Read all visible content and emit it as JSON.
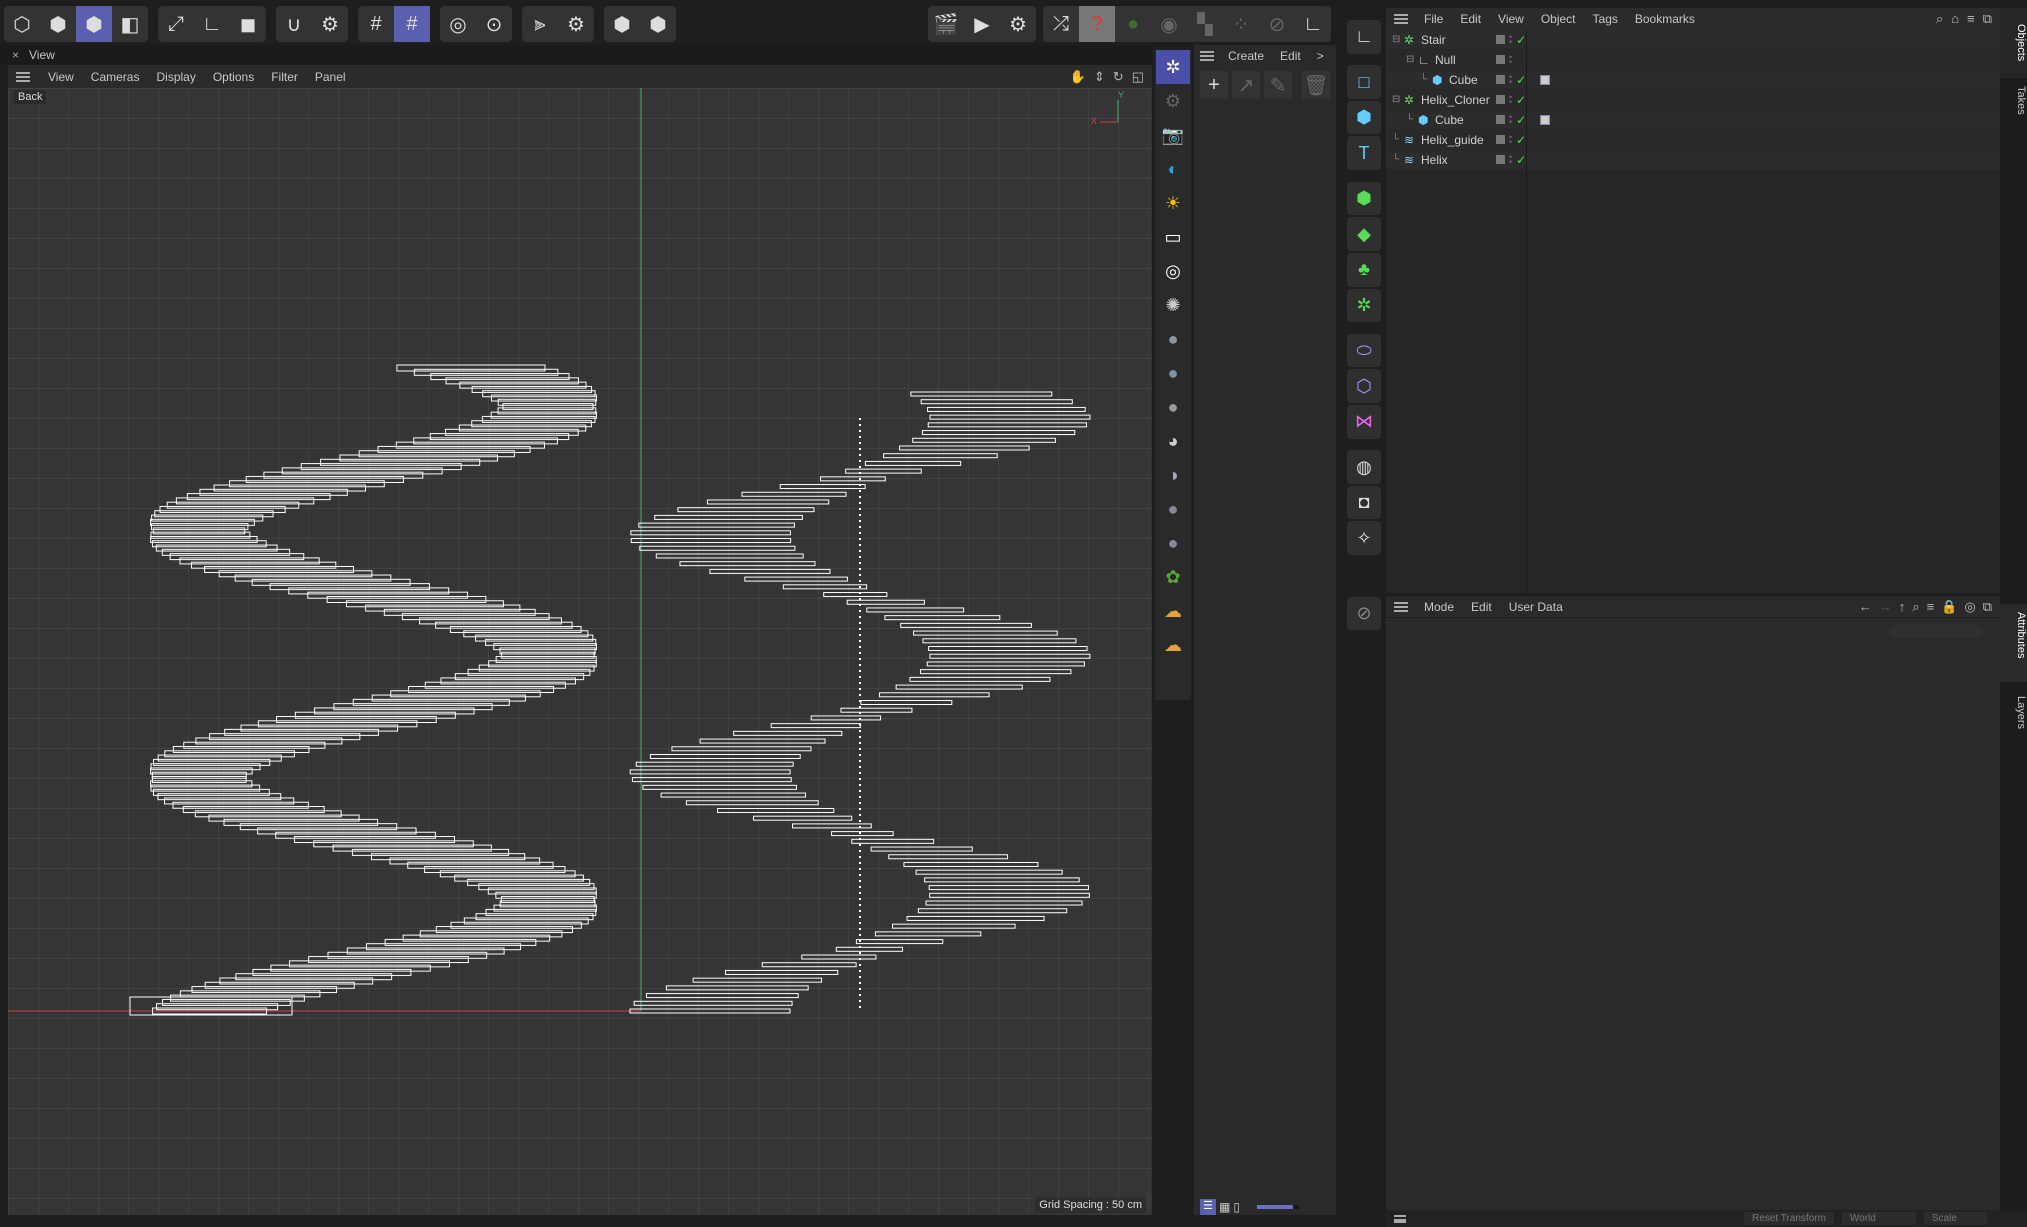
{
  "toolbar": {
    "groups": [
      {
        "icons": [
          "object-mode-icon",
          "point-mode-icon",
          "model-mode-icon",
          "polygon-mode-icon"
        ],
        "active": 2
      },
      {
        "icons": [
          "axis-move-icon",
          "axis-corner-icon",
          "texture-icon"
        ],
        "active": -1
      },
      {
        "icons": [
          "snap-magnet-icon",
          "snap-settings-icon"
        ],
        "active": -1
      },
      {
        "icons": [
          "grid-snap-icon",
          "grid-lock-icon"
        ],
        "active": 1
      },
      {
        "icons": [
          "soft-select-icon",
          "soft-settings-icon"
        ],
        "active": -1
      },
      {
        "icons": [
          "symmetry-icon",
          "symmetry-settings-icon"
        ],
        "active": -1
      },
      {
        "icons": [
          "viewport-solo-icon",
          "solo-hierarchy-icon"
        ],
        "active": -1
      }
    ],
    "render_icons": [
      "render-view-icon",
      "render-picture-icon",
      "render-settings-icon"
    ],
    "octane_icons": [
      "shuffle-icon",
      "octane-help-icon",
      "octane-ball-icon",
      "eye-icon",
      "checker-pin-icon",
      "dots-icon",
      "disable-icon",
      "axis-point-icon"
    ]
  },
  "view_panel": {
    "tab_title": "View",
    "menu": [
      "View",
      "Cameras",
      "Display",
      "Options",
      "Filter",
      "Panel"
    ],
    "camera_label": "Back",
    "grid_spacing": "Grid Spacing : 50 cm",
    "axis": {
      "x": "X",
      "y": "Y"
    },
    "colors": {
      "x_axis": "#c94444",
      "y_axis": "#3fb36c"
    }
  },
  "create_panel": {
    "menu": [
      "Create",
      "Edit",
      ">"
    ]
  },
  "objects": {
    "menu": [
      "File",
      "Edit",
      "View",
      "Object",
      "Tags",
      "Bookmarks"
    ],
    "items": [
      {
        "name": "Stair",
        "depth": 0,
        "icon": "cloner-icon",
        "expand": true,
        "check": true,
        "tag": false
      },
      {
        "name": "Null",
        "depth": 1,
        "icon": "null-icon",
        "expand": true,
        "check": false,
        "tag": false
      },
      {
        "name": "Cube",
        "depth": 2,
        "icon": "cube-icon",
        "expand": false,
        "check": true,
        "tag": true
      },
      {
        "name": "Helix_Cloner",
        "depth": 0,
        "icon": "cloner-icon",
        "expand": true,
        "check": true,
        "tag": false
      },
      {
        "name": "Cube",
        "depth": 1,
        "icon": "cube-icon",
        "expand": false,
        "check": true,
        "tag": true
      },
      {
        "name": "Helix_guide",
        "depth": 0,
        "icon": "spline-icon",
        "expand": false,
        "check": true,
        "tag": false
      },
      {
        "name": "Helix",
        "depth": 0,
        "icon": "spline-icon",
        "expand": false,
        "check": true,
        "tag": false
      }
    ]
  },
  "attributes": {
    "menu": [
      "Mode",
      "Edit",
      "User Data"
    ]
  },
  "side_tabs": {
    "top": [
      "Objects",
      "Takes"
    ],
    "bottom": [
      "Attributes",
      "Layers"
    ]
  },
  "bottom_bar": {
    "reset": "Reset Transform",
    "space": "World",
    "mode": "Scale"
  },
  "zoom_slider": 0.85
}
